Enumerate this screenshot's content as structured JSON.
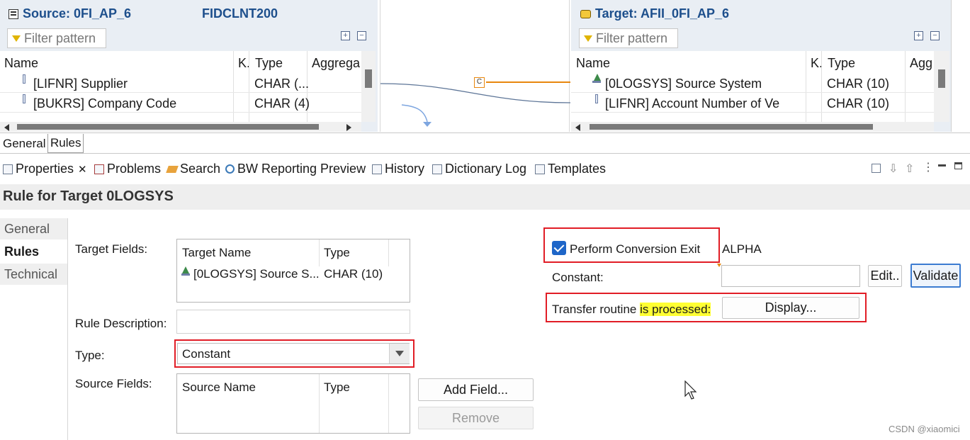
{
  "source": {
    "title": "Source: 0FI_AP_6",
    "system": "FIDCLNT200",
    "filter_placeholder": "Filter pattern",
    "columns": [
      "Name",
      "K.",
      "Type",
      "Aggrega"
    ],
    "rows": [
      {
        "name": "[LIFNR] Supplier",
        "type": "CHAR (..."
      },
      {
        "name": "[BUKRS] Company Code",
        "type": "CHAR (4)"
      }
    ]
  },
  "target": {
    "title": "Target: AFII_0FI_AP_6",
    "filter_placeholder": "Filter pattern",
    "columns": [
      "Name",
      "K.",
      "Type",
      "Agg"
    ],
    "rows": [
      {
        "name": "[0LOGSYS] Source System",
        "type": "CHAR (10)"
      },
      {
        "name": "[LIFNR] Account Number of Ve",
        "type": "CHAR (10)"
      }
    ]
  },
  "mapping": {
    "rule_marker": "C"
  },
  "editor_tabs": [
    "General",
    "Rules"
  ],
  "view_tabs": [
    "Properties",
    "Problems",
    "Search",
    "BW Reporting Preview",
    "History",
    "Dictionary Log",
    "Templates"
  ],
  "properties": {
    "header": "Rule for Target 0LOGSYS",
    "side_tabs": [
      "General",
      "Rules",
      "Technical"
    ],
    "target_fields_label": "Target Fields:",
    "target_table": {
      "columns": [
        "Target Name",
        "Type"
      ],
      "rows": [
        {
          "name": "[0LOGSYS] Source S...",
          "type": "CHAR (10)"
        }
      ]
    },
    "rule_description_label": "Rule Description:",
    "rule_description_value": "",
    "type_label": "Type:",
    "type_value": "Constant",
    "source_fields_label": "Source Fields:",
    "source_table": {
      "columns": [
        "Source Name",
        "Type"
      ]
    },
    "add_field_button": "Add Field...",
    "remove_button": "Remove",
    "conversion_exit_label": "Perform Conversion Exit",
    "conversion_exit_checked": true,
    "conversion_exit_value": "ALPHA",
    "constant_label": "Constant:",
    "constant_value": "",
    "edit_button": "Edit..",
    "validate_button": "Validate",
    "transfer_routine_label": "Transfer routine",
    "transfer_routine_status": "is processed:",
    "display_button": "Display..."
  },
  "watermark": "CSDN @xiaomici",
  "colors": {
    "title_blue": "#1d4f8c",
    "annotation_red": "#e11d26",
    "highlight_yellow": "#ffff33",
    "mapping_orange": "#e8870e"
  }
}
